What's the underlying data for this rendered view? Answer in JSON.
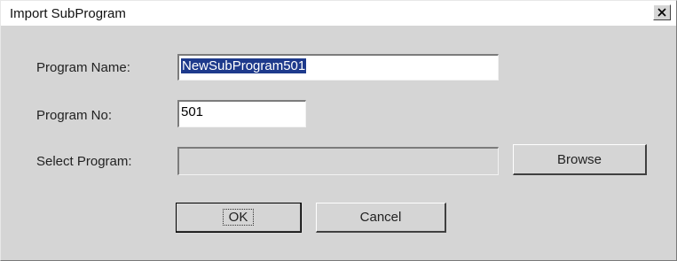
{
  "window": {
    "title": "Import SubProgram"
  },
  "form": {
    "program_name_label": "Program Name:",
    "program_name_value": "NewSubProgram501",
    "program_no_label": "Program No:",
    "program_no_value": "501",
    "select_program_label": "Select Program:",
    "select_program_value": ""
  },
  "buttons": {
    "browse": "Browse",
    "ok": "OK",
    "cancel": "Cancel"
  },
  "icons": {
    "close": "close-icon"
  }
}
